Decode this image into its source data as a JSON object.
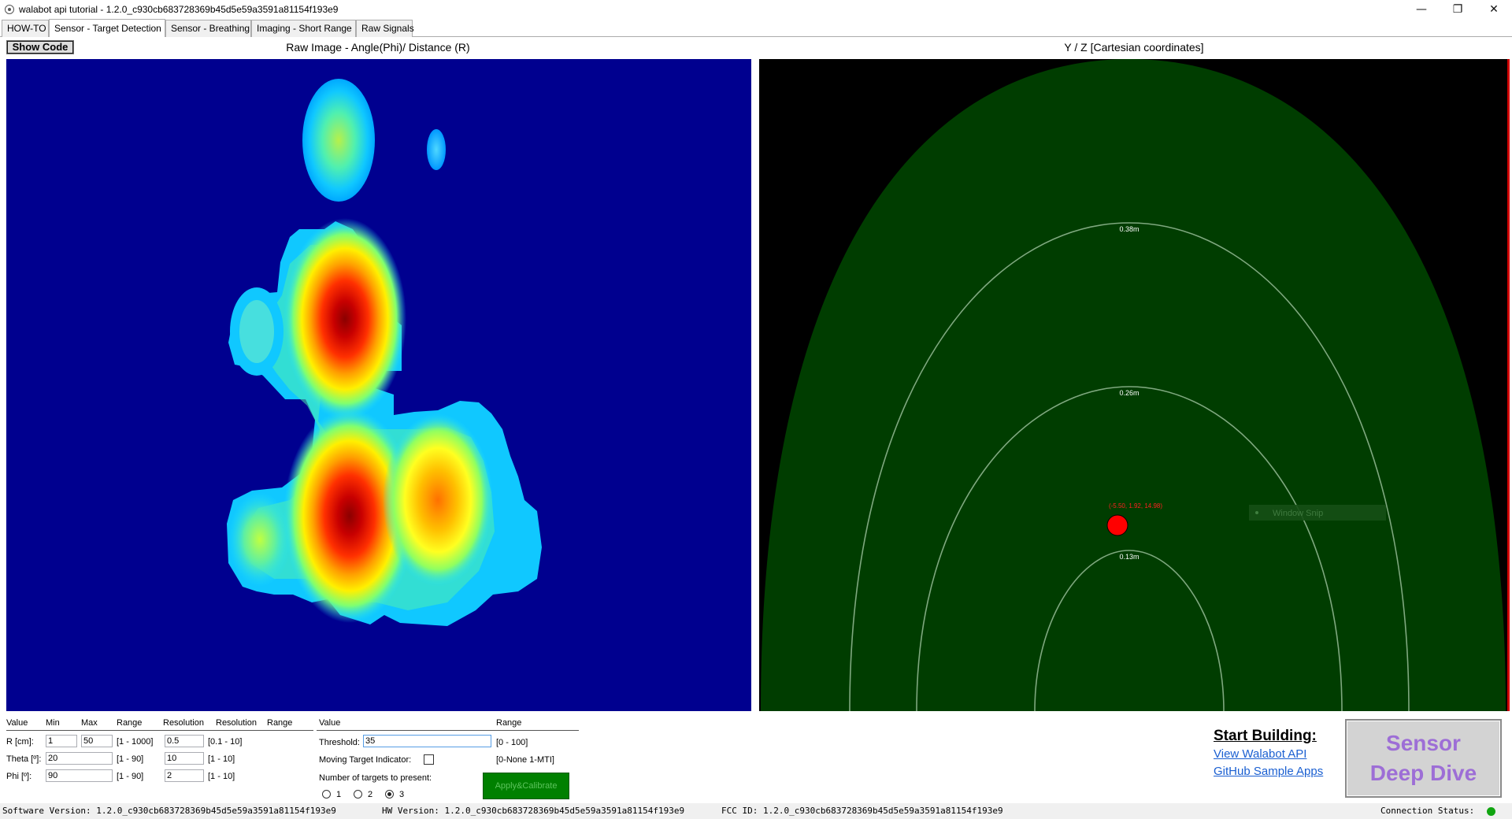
{
  "window": {
    "title": "walabot api tutorial - 1.2.0_c930cb683728369b45d5e59a3591a81154f193e9",
    "minimize_glyph": "—",
    "restore_glyph": "❐",
    "close_glyph": "✕"
  },
  "tabs": [
    {
      "label": "HOW-TO",
      "active": false
    },
    {
      "label": "Sensor - Target Detection",
      "active": true
    },
    {
      "label": "Sensor - Breathing",
      "active": false
    },
    {
      "label": "Imaging - Short Range",
      "active": false
    },
    {
      "label": "Raw Signals",
      "active": false
    }
  ],
  "toolbar": {
    "show_code_label": "Show Code"
  },
  "raw_panel": {
    "title": "Raw Image - Angle(Phi)/ Distance (R)"
  },
  "cart_panel": {
    "title": "Y / Z [Cartesian coordinates]",
    "arc_labels": [
      "0.38m",
      "0.26m",
      "0.13m"
    ],
    "target_label": "(-5.50, 1.92, 14.98)",
    "target_color": "#ff0000",
    "field_color": "#003d00",
    "arc_color": "#7fa87f",
    "snip_label": "Window Snip"
  },
  "arena": {
    "headers": {
      "value": "Value",
      "min": "Min",
      "max": "Max",
      "range": "Range",
      "resolution": "Resolution",
      "resolution2": "Resolution",
      "range2": "Range"
    },
    "rows": [
      {
        "label": "R [cm]:",
        "min": "1",
        "max": "50",
        "range": "[1 - 1000]",
        "res": "0.5",
        "res_range": "[0.1 - 10]"
      },
      {
        "label": "Theta [º]:",
        "min": "20",
        "max": "",
        "range": "[1 - 90]",
        "res": "10",
        "res_range": "[1 - 10]"
      },
      {
        "label": "Phi [º]:",
        "min": "90",
        "max": "",
        "range": "[1 - 90]",
        "res": "2",
        "res_range": "[1 - 10]"
      }
    ]
  },
  "detection": {
    "headers": {
      "value": "Value",
      "range": "Range"
    },
    "threshold_label": "Threshold:",
    "threshold_value": "35",
    "threshold_range": "[0 - 100]",
    "mti_label": "Moving Target Indicator:",
    "mti_checked": false,
    "mti_range": "[0-None 1-MTI]",
    "targets_label": "Number of targets to present:",
    "target_options": [
      "1",
      "2",
      "3"
    ],
    "target_selected": "3",
    "apply_label": "Apply&Calibrate"
  },
  "promo": {
    "start_building": "Start Building:",
    "api_link": "View Walabot API",
    "github_link": "GitHub Sample Apps",
    "deep_dive_line1": "Sensor",
    "deep_dive_line2": "Deep Dive"
  },
  "status": {
    "software": "Software Version: 1.2.0_c930cb683728369b45d5e59a3591a81154f193e9",
    "hw": "HW Version: 1.2.0_c930cb683728369b45d5e59a3591a81154f193e9",
    "fcc": "FCC ID: 1.2.0_c930cb683728369b45d5e59a3591a81154f193e9",
    "connection": "Connection Status:",
    "connection_color": "#11a511"
  }
}
